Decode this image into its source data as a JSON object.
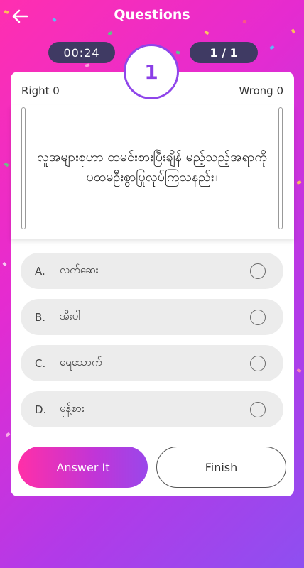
{
  "header": {
    "title": "Questions",
    "back_icon": "arrow-left-icon"
  },
  "status": {
    "timer": "00:24",
    "progress": "1 / 1",
    "question_number": "1"
  },
  "score": {
    "right_label": "Right 0",
    "wrong_label": "Wrong 0"
  },
  "question": {
    "text": "လူအများစုဟာ ထမင်းစားပြီးချိန် မည့်သည့်အရာကို ပထမဦးစွာပြုလုပ်ကြသနည်း။"
  },
  "options": [
    {
      "letter": "A.",
      "text": "လက်ဆေး",
      "selected": false
    },
    {
      "letter": "B.",
      "text": "အီးပါ",
      "selected": false
    },
    {
      "letter": "C.",
      "text": "ရေသောက်",
      "selected": false
    },
    {
      "letter": "D.",
      "text": "မုန့်စား",
      "selected": false
    }
  ],
  "buttons": {
    "answer": "Answer It",
    "finish": "Finish"
  },
  "colors": {
    "primary": "#8a3ee6",
    "pill_bg": "#3f3a63",
    "gradient_start": "#ff2fb0",
    "gradient_end": "#8e4ff0"
  }
}
